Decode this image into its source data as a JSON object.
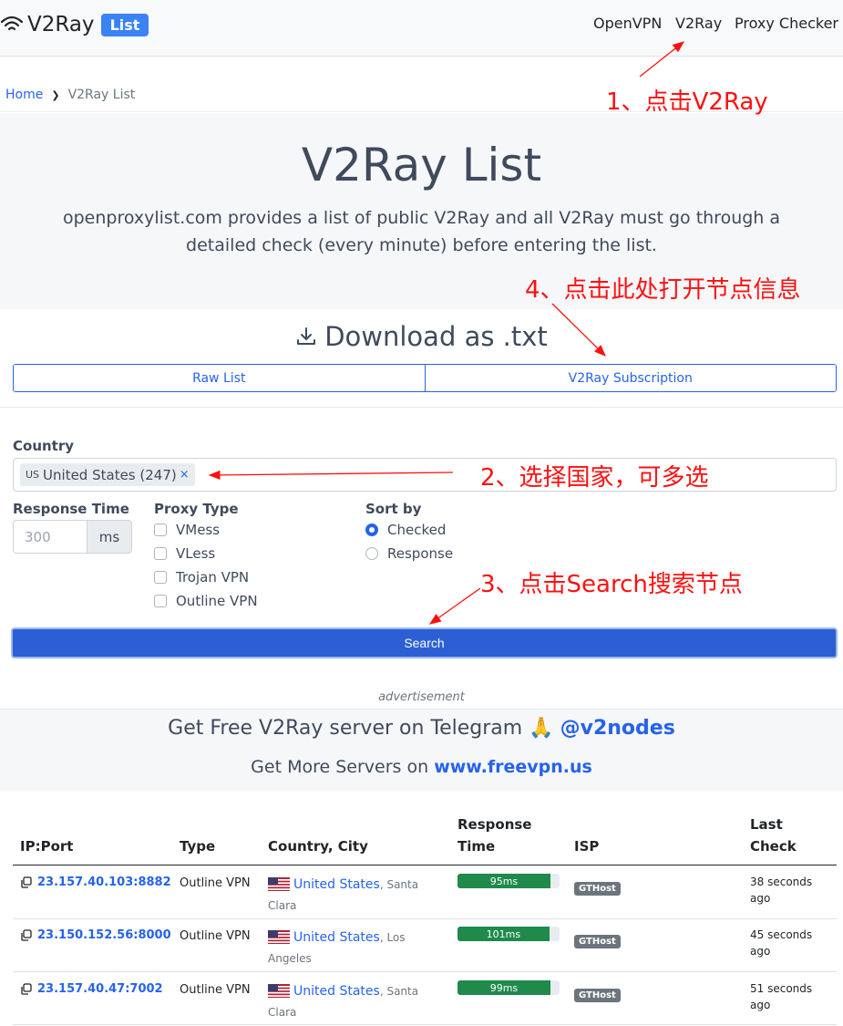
{
  "brand": {
    "name": "V2Ray",
    "badge": "List"
  },
  "nav": {
    "links": [
      "OpenVPN",
      "V2Ray",
      "Proxy Checker"
    ]
  },
  "breadcrumb": {
    "home": "Home",
    "current": "V2Ray List"
  },
  "hero": {
    "title": "V2Ray List",
    "description": "openproxylist.com provides a list of public V2Ray and all V2Ray must go through a detailed check (every minute) before entering the list."
  },
  "download": {
    "title": "Download as .txt",
    "raw_label": "Raw List",
    "subscription_label": "V2Ray Subscription"
  },
  "filter": {
    "country_label": "Country",
    "country_tag": {
      "code": "US",
      "text": "United States (247)",
      "remove": "×"
    },
    "response_label": "Response Time",
    "response_placeholder": "300",
    "response_unit": "ms",
    "proxy_label": "Proxy Type",
    "proxy_types": [
      "VMess",
      "VLess",
      "Trojan VPN",
      "Outline VPN"
    ],
    "sort_label": "Sort by",
    "sort_options": [
      "Checked",
      "Response"
    ],
    "sort_selected": "Checked",
    "search_label": "Search"
  },
  "ad": {
    "label": "advertisement",
    "telegram_text": "Get Free V2Ray server on Telegram",
    "telegram_emoji": "🙏",
    "telegram_handle": "@v2nodes",
    "freevpn_text": "Get More Servers on",
    "freevpn_site": "www.freevpn.us"
  },
  "table": {
    "headers": {
      "ipport": "IP:Port",
      "type": "Type",
      "country": "Country, City",
      "response_1": "Response",
      "response_2": "Time",
      "isp": "ISP",
      "last_1": "Last",
      "last_2": "Check"
    },
    "rows": [
      {
        "ip": "23.157.40.103:8882",
        "type": "Outline VPN",
        "country": "United States",
        "city_a": "Santa",
        "city_b": "Clara",
        "response": "95ms",
        "response_fraction": 0.91,
        "isp": "GTHost",
        "last_a": "38 seconds",
        "last_b": "ago"
      },
      {
        "ip": "23.150.152.56:8000",
        "type": "Outline VPN",
        "country": "United States",
        "city_a": "Los",
        "city_b": "Angeles",
        "response": "101ms",
        "response_fraction": 0.9,
        "isp": "GTHost",
        "last_a": "45 seconds",
        "last_b": "ago"
      },
      {
        "ip": "23.157.40.47:7002",
        "type": "Outline VPN",
        "country": "United States",
        "city_a": "Santa",
        "city_b": "Clara",
        "response": "99ms",
        "response_fraction": 0.91,
        "isp": "GTHost",
        "last_a": "51 seconds",
        "last_b": "ago"
      }
    ]
  },
  "annotations": {
    "step1": "1、点击V2Ray",
    "step2": "2、选择国家，可多选",
    "step3": "3、点击Search搜索节点",
    "step4": "4、点击此处打开节点信息"
  },
  "colors": {
    "accent": "#2563eb",
    "annotation": "#ff1010",
    "response_bar": "#1f8a4c",
    "search_button": "#2c5fd4"
  }
}
